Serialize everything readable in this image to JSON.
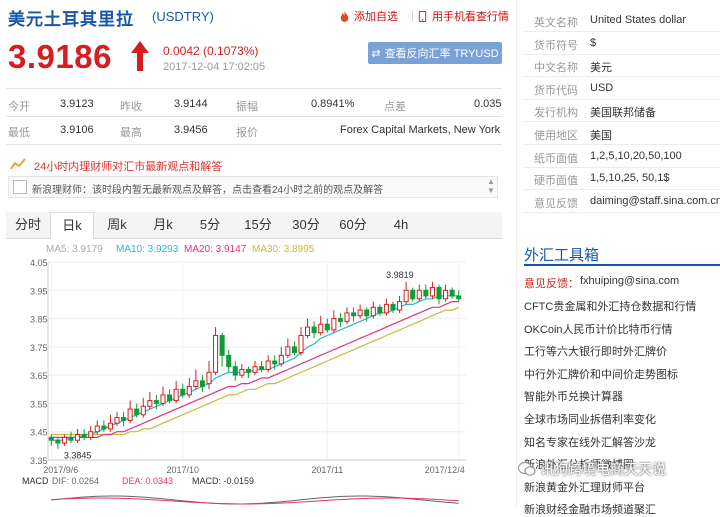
{
  "header": {
    "title": "美元土耳其里拉",
    "code": "(USDTRY)",
    "add_watch": "添加自选",
    "mobile_quote": "用手机看查行情",
    "price": "3.9186",
    "change": "0.0042 (0.1073%)",
    "time": "2017-12-04 17:02:05",
    "reverse_button": "查看反向汇率 TRYUSD"
  },
  "stats": [
    {
      "label": "今开",
      "value": "3.9123"
    },
    {
      "label": "昨收",
      "value": "3.9144"
    },
    {
      "label": "振幅",
      "value": "0.8941%"
    },
    {
      "label": "点差",
      "value": "0.035"
    },
    {
      "label": "最低",
      "value": "3.9106"
    },
    {
      "label": "最高",
      "value": "3.9456"
    },
    {
      "label": "报价",
      "value": "Forex Capital Markets, New York"
    }
  ],
  "notice": {
    "title": "24小时内理财师对汇市最新观点和解答",
    "text": "新浪理财师：该时段内暂无最新观点及解答，点击查看24小时之前的观点及解答"
  },
  "tabs": [
    "分时",
    "日k",
    "周k",
    "月k",
    "5分",
    "15分",
    "30分",
    "60分",
    "4h"
  ],
  "active_tab": "日k",
  "legend": {
    "ma5": "MA5: 3.9179",
    "ma10": "MA10: 3.9293",
    "ma20": "MA20: 3.9147",
    "ma30": "MA30: 3.8995"
  },
  "colors": {
    "up": "#d71e1e",
    "down": "#139b38",
    "ma5": "#c0c0c0",
    "ma10": "#2bb6d6",
    "ma20": "#e0347a",
    "ma30": "#c9bb3a",
    "link_blue": "#1a56a8"
  },
  "macd": {
    "macd_label": "MACD",
    "dif": "DIF: 0.0264",
    "dea": "DEA: 0.0343",
    "macd": "MACD: -0.0159"
  },
  "chart_data": {
    "type": "candlestick",
    "y_ticks": [
      "4.05",
      "3.95",
      "3.85",
      "3.75",
      "3.65",
      "3.55",
      "3.45",
      "3.35"
    ],
    "ylim": [
      3.35,
      4.05
    ],
    "x_ticks": [
      "2017/9/6",
      "2017/10",
      "2017/11",
      "2017/12/4"
    ],
    "annotations": {
      "high": "3.9819",
      "low": "3.3845"
    },
    "candles": [
      [
        3.43,
        3.42,
        3.44,
        3.4
      ],
      [
        3.42,
        3.41,
        3.43,
        3.39
      ],
      [
        3.41,
        3.43,
        3.44,
        3.4
      ],
      [
        3.43,
        3.42,
        3.45,
        3.41
      ],
      [
        3.42,
        3.44,
        3.46,
        3.41
      ],
      [
        3.44,
        3.43,
        3.46,
        3.42
      ],
      [
        3.43,
        3.45,
        3.47,
        3.42
      ],
      [
        3.45,
        3.47,
        3.49,
        3.44
      ],
      [
        3.47,
        3.46,
        3.49,
        3.45
      ],
      [
        3.46,
        3.48,
        3.51,
        3.45
      ],
      [
        3.48,
        3.5,
        3.52,
        3.47
      ],
      [
        3.5,
        3.49,
        3.52,
        3.47
      ],
      [
        3.49,
        3.53,
        3.56,
        3.48
      ],
      [
        3.53,
        3.51,
        3.55,
        3.5
      ],
      [
        3.51,
        3.54,
        3.57,
        3.5
      ],
      [
        3.54,
        3.56,
        3.59,
        3.53
      ],
      [
        3.56,
        3.55,
        3.58,
        3.53
      ],
      [
        3.55,
        3.58,
        3.61,
        3.54
      ],
      [
        3.58,
        3.56,
        3.6,
        3.55
      ],
      [
        3.56,
        3.6,
        3.63,
        3.55
      ],
      [
        3.6,
        3.58,
        3.62,
        3.57
      ],
      [
        3.58,
        3.61,
        3.64,
        3.57
      ],
      [
        3.61,
        3.63,
        3.67,
        3.6
      ],
      [
        3.63,
        3.61,
        3.65,
        3.59
      ],
      [
        3.62,
        3.66,
        3.7,
        3.6
      ],
      [
        3.66,
        3.79,
        3.82,
        3.65
      ],
      [
        3.79,
        3.72,
        3.8,
        3.68
      ],
      [
        3.72,
        3.68,
        3.74,
        3.66
      ],
      [
        3.68,
        3.65,
        3.7,
        3.63
      ],
      [
        3.65,
        3.67,
        3.69,
        3.64
      ],
      [
        3.67,
        3.66,
        3.68,
        3.64
      ],
      [
        3.66,
        3.68,
        3.7,
        3.65
      ],
      [
        3.68,
        3.67,
        3.7,
        3.66
      ],
      [
        3.67,
        3.7,
        3.72,
        3.66
      ],
      [
        3.7,
        3.69,
        3.72,
        3.67
      ],
      [
        3.69,
        3.72,
        3.75,
        3.68
      ],
      [
        3.72,
        3.75,
        3.78,
        3.71
      ],
      [
        3.75,
        3.73,
        3.77,
        3.72
      ],
      [
        3.73,
        3.79,
        3.82,
        3.72
      ],
      [
        3.79,
        3.82,
        3.85,
        3.78
      ],
      [
        3.82,
        3.8,
        3.84,
        3.78
      ],
      [
        3.8,
        3.83,
        3.86,
        3.79
      ],
      [
        3.83,
        3.81,
        3.85,
        3.8
      ],
      [
        3.81,
        3.85,
        3.88,
        3.8
      ],
      [
        3.85,
        3.84,
        3.87,
        3.82
      ],
      [
        3.84,
        3.87,
        3.89,
        3.83
      ],
      [
        3.87,
        3.86,
        3.89,
        3.84
      ],
      [
        3.86,
        3.88,
        3.9,
        3.85
      ],
      [
        3.88,
        3.86,
        3.89,
        3.84
      ],
      [
        3.86,
        3.89,
        3.91,
        3.85
      ],
      [
        3.89,
        3.87,
        3.9,
        3.86
      ],
      [
        3.87,
        3.9,
        3.92,
        3.86
      ],
      [
        3.9,
        3.88,
        3.91,
        3.87
      ],
      [
        3.88,
        3.91,
        3.93,
        3.87
      ],
      [
        3.91,
        3.95,
        3.98,
        3.9
      ],
      [
        3.95,
        3.92,
        3.96,
        3.91
      ],
      [
        3.92,
        3.95,
        3.97,
        3.91
      ],
      [
        3.95,
        3.93,
        3.97,
        3.92
      ],
      [
        3.93,
        3.96,
        3.98,
        3.92
      ],
      [
        3.96,
        3.92,
        3.97,
        3.9
      ],
      [
        3.92,
        3.95,
        3.97,
        3.91
      ],
      [
        3.95,
        3.93,
        3.96,
        3.92
      ],
      [
        3.93,
        3.92,
        3.95,
        3.91
      ]
    ],
    "ma10": [
      3.42,
      3.42,
      3.42,
      3.43,
      3.43,
      3.44,
      3.44,
      3.45,
      3.46,
      3.47,
      3.48,
      3.49,
      3.5,
      3.51,
      3.52,
      3.53,
      3.54,
      3.55,
      3.56,
      3.57,
      3.58,
      3.59,
      3.6,
      3.61,
      3.62,
      3.64,
      3.65,
      3.66,
      3.66,
      3.66,
      3.66,
      3.67,
      3.67,
      3.67,
      3.68,
      3.69,
      3.7,
      3.71,
      3.73,
      3.75,
      3.76,
      3.78,
      3.79,
      3.8,
      3.81,
      3.82,
      3.83,
      3.84,
      3.85,
      3.86,
      3.87,
      3.87,
      3.88,
      3.89,
      3.9,
      3.9,
      3.91,
      3.92,
      3.92,
      3.93,
      3.93,
      3.93,
      3.93
    ],
    "ma20": [
      3.43,
      3.43,
      3.43,
      3.43,
      3.43,
      3.43,
      3.43,
      3.43,
      3.44,
      3.44,
      3.45,
      3.45,
      3.46,
      3.47,
      3.48,
      3.49,
      3.5,
      3.51,
      3.52,
      3.53,
      3.54,
      3.55,
      3.56,
      3.57,
      3.58,
      3.59,
      3.6,
      3.61,
      3.61,
      3.62,
      3.62,
      3.63,
      3.64,
      3.64,
      3.65,
      3.66,
      3.67,
      3.68,
      3.69,
      3.7,
      3.71,
      3.72,
      3.73,
      3.74,
      3.75,
      3.76,
      3.77,
      3.78,
      3.79,
      3.8,
      3.81,
      3.82,
      3.83,
      3.84,
      3.85,
      3.86,
      3.87,
      3.88,
      3.89,
      3.89,
      3.9,
      3.91,
      3.91
    ],
    "ma30": [
      3.44,
      3.44,
      3.44,
      3.44,
      3.44,
      3.44,
      3.44,
      3.44,
      3.44,
      3.44,
      3.44,
      3.44,
      3.45,
      3.45,
      3.46,
      3.46,
      3.47,
      3.48,
      3.49,
      3.5,
      3.51,
      3.52,
      3.53,
      3.54,
      3.55,
      3.56,
      3.57,
      3.58,
      3.58,
      3.59,
      3.6,
      3.6,
      3.61,
      3.62,
      3.62,
      3.63,
      3.64,
      3.65,
      3.66,
      3.67,
      3.68,
      3.69,
      3.7,
      3.71,
      3.72,
      3.73,
      3.74,
      3.75,
      3.76,
      3.77,
      3.78,
      3.79,
      3.8,
      3.81,
      3.82,
      3.83,
      3.84,
      3.85,
      3.86,
      3.87,
      3.88,
      3.88,
      3.89
    ]
  },
  "right_panel": {
    "info": [
      {
        "label": "英文名称",
        "value": "United States dollar"
      },
      {
        "label": "货币符号",
        "value": "$"
      },
      {
        "label": "中文名称",
        "value": "美元"
      },
      {
        "label": "货币代码",
        "value": "USD"
      },
      {
        "label": "发行机构",
        "value": "美国联邦储备"
      },
      {
        "label": "使用地区",
        "value": "美国"
      },
      {
        "label": "纸币面值",
        "value": "1,2,5,10,20,50,100"
      },
      {
        "label": "硬币面值",
        "value": "1,5,10,25, 50,1$"
      },
      {
        "label": "意见反馈",
        "value": "daiming@staff.sina.com.cn"
      }
    ],
    "tools_title": "外汇工具箱",
    "feedback_label": "意见反馈：",
    "feedback_email": "fxhuiping@sina.com",
    "links": [
      "CFTC贵金属和外汇持仓数据和行情",
      "OKCoin人民币计价比特币行情",
      "工行等六大银行即时外汇牌价",
      "中行外汇牌价和中间价走势图标",
      "智能外币兑换计算器",
      "全球市场同业拆借利率变化",
      "知名专家在线外汇解答沙龙",
      "新浪外汇分析师微博圈",
      "新浪黄金外汇理财师平台",
      "新浪财经金融市场频道聚汇"
    ],
    "watermark": "讯狗跨境电商天天说"
  }
}
